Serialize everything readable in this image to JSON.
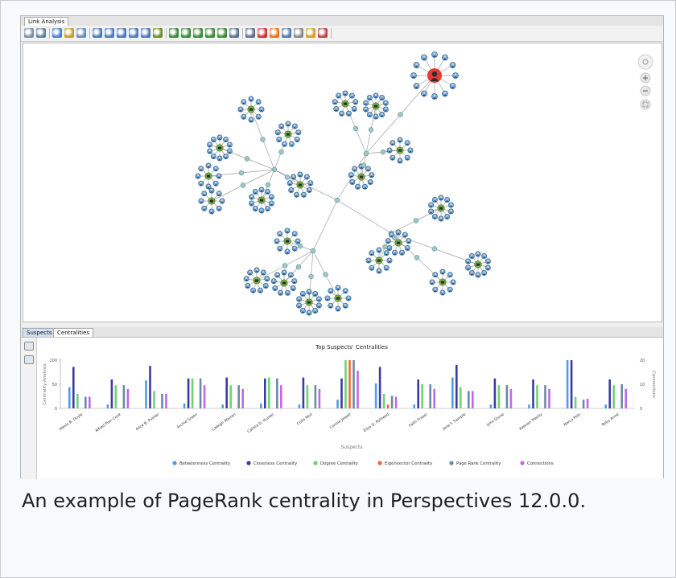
{
  "window": {
    "tab_title": "Link Analysis"
  },
  "toolbar": {
    "icons": [
      "copy-icon",
      "save-icon",
      "select-icon",
      "pan-hand-icon",
      "move-icon",
      "zoom-icon",
      "zoom-in-icon",
      "zoom-out-icon",
      "zoom-fit-icon",
      "zoom-select-icon",
      "expand-icon",
      "layout-hierarchy-icon",
      "layout-circle-icon",
      "layout-organic-icon",
      "layout-grid-icon",
      "layout-tree-icon",
      "centrality-icon",
      "find-path-icon",
      "shortest-path-icon",
      "highlight-icon",
      "cluster-icon",
      "remove-icon",
      "filter-icon",
      "settings-icon"
    ]
  },
  "lower_tabs": {
    "tab1": "Suspects",
    "tab2": "Centralities"
  },
  "navigator": {
    "icons": [
      "pan-control-icon",
      "zoom-in-icon",
      "zoom-out-icon",
      "fit-screen-icon"
    ]
  },
  "chart_data": {
    "type": "bar",
    "title": "Top Suspects' Centralities",
    "xlabel": "Suspects",
    "ylabel": "Centrality Analysis",
    "y2label": "Connections",
    "ylim": [
      0,
      100
    ],
    "y2lim": [
      0,
      20
    ],
    "yticks": [
      "100",
      "50",
      "0"
    ],
    "y2ticks": [
      "20",
      "10",
      "0"
    ],
    "legend_position": "bottom",
    "categories": [
      "Alexis B. Doyle",
      "Alfred Plan Cook",
      "Alice B. Pusher",
      "Archie Green",
      "Caleigh Warren",
      "Calista D. Hunter",
      "Colla Moll",
      "Connie Jewell",
      "Eliza D. Pothead",
      "Faith Fraser",
      "Jane F. Sample",
      "John Stone",
      "Keenan Trestly",
      "Narco Polo",
      "Roby Anne"
    ],
    "series": [
      {
        "name": "Betweenness Centrality",
        "color": "#4f9ee6",
        "values": [
          44,
          8,
          58,
          10,
          8,
          10,
          8,
          18,
          52,
          8,
          64,
          8,
          8,
          100,
          8
        ]
      },
      {
        "name": "Closeness Centrality",
        "color": "#3d39a8",
        "values": [
          86,
          60,
          88,
          62,
          64,
          62,
          64,
          62,
          86,
          60,
          90,
          62,
          60,
          100,
          60
        ]
      },
      {
        "name": "Degree Centrality",
        "color": "#6fd36f",
        "values": [
          30,
          48,
          36,
          62,
          48,
          64,
          48,
          100,
          30,
          50,
          44,
          48,
          48,
          24,
          48
        ]
      },
      {
        "name": "Eigenvector Centrality",
        "color": "#ee6a34",
        "values": [
          0,
          0,
          0,
          0,
          0,
          0,
          0,
          100,
          8,
          0,
          0,
          0,
          0,
          0,
          0
        ]
      },
      {
        "name": "Page Rank Centrality",
        "color": "#6a8aa6",
        "values": [
          24,
          48,
          30,
          62,
          48,
          62,
          48,
          100,
          26,
          50,
          36,
          48,
          48,
          18,
          50
        ]
      },
      {
        "name": "Connections",
        "color": "#c367e6",
        "values": [
          24,
          40,
          30,
          48,
          40,
          48,
          40,
          78,
          24,
          40,
          36,
          40,
          40,
          20,
          40
        ]
      }
    ]
  },
  "caption": {
    "text": "An example of PageRank centrality in Perspectives 12.0.0."
  }
}
